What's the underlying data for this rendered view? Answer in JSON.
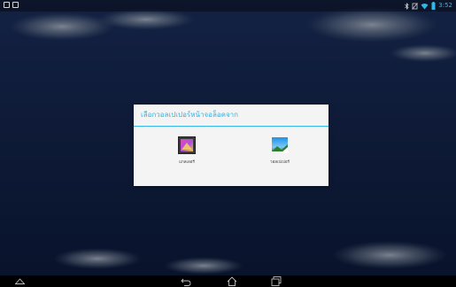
{
  "status_bar": {
    "time": "3:52",
    "left_icons": [
      "image-notification-icon",
      "screenshot-notification-icon"
    ],
    "right_icons": [
      "bluetooth-icon",
      "no-sim-icon",
      "wifi-icon",
      "battery-icon"
    ]
  },
  "dialog": {
    "title": "เลือกวอลเปเปอร์หน้าจอล็อคจาก",
    "options": [
      {
        "label": "แกลเลอรี",
        "icon": "gallery-icon"
      },
      {
        "label": "วอลเปเปอร์",
        "icon": "wallpapers-icon"
      }
    ],
    "accent_color": "#33b5e5"
  },
  "navigation_bar": {
    "buttons": [
      "expand-up-icon",
      "back-icon",
      "home-icon",
      "recents-icon"
    ]
  }
}
